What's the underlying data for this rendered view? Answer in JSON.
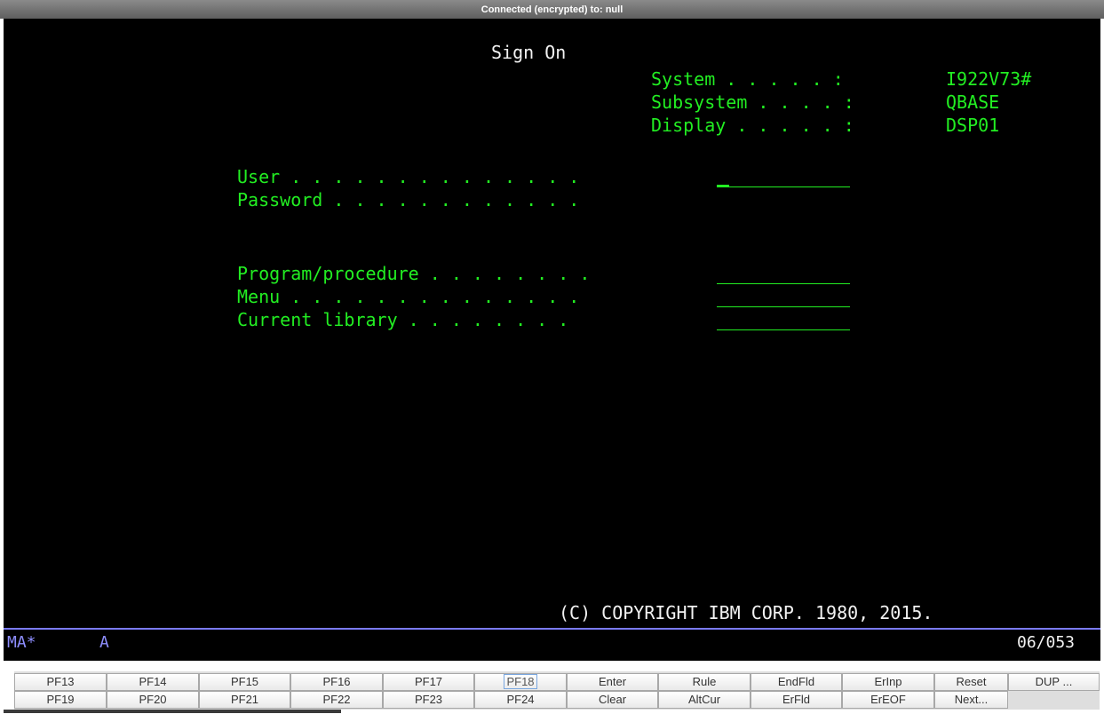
{
  "window": {
    "title": "Connected (encrypted) to: null"
  },
  "screen": {
    "heading": "Sign On",
    "system_info": [
      {
        "label": "System . . . . . :",
        "value": "I922V73#"
      },
      {
        "label": "Subsystem . . . . :",
        "value": "QBASE"
      },
      {
        "label": "Display . . . . . :",
        "value": "DSP01"
      }
    ],
    "fields": [
      {
        "label": "User . . . . . . . . . . . . . .",
        "value": ""
      },
      {
        "label": "Password . . . . . . . . . . . .",
        "value": ""
      },
      {
        "label": "Program/procedure . . . . . . . .",
        "value": ""
      },
      {
        "label": "Menu . . . . . . . . . . . . . .",
        "value": ""
      },
      {
        "label": "Current library . . . . . . . .",
        "value": ""
      }
    ],
    "copyright": "(C) COPYRIGHT IBM CORP. 1980, 2015."
  },
  "status_line": {
    "mode": "MA*",
    "indicator": "A",
    "cursor_pos": "06/053"
  },
  "keypad": {
    "row1": [
      "PF13",
      "PF14",
      "PF15",
      "PF16",
      "PF17",
      "PF18",
      "Enter",
      "Rule",
      "EndFld",
      "ErInp",
      "Reset",
      "DUP ..."
    ],
    "row2": [
      "PF19",
      "PF20",
      "PF21",
      "PF22",
      "PF23",
      "PF24",
      "Clear",
      "AltCur",
      "ErFld",
      "ErEOF",
      "Next..."
    ]
  },
  "colors": {
    "screen_bg": "#000000",
    "text_green": "#22ee22",
    "text_white": "#f2f2f2",
    "oia_blue": "#8e8eff"
  }
}
